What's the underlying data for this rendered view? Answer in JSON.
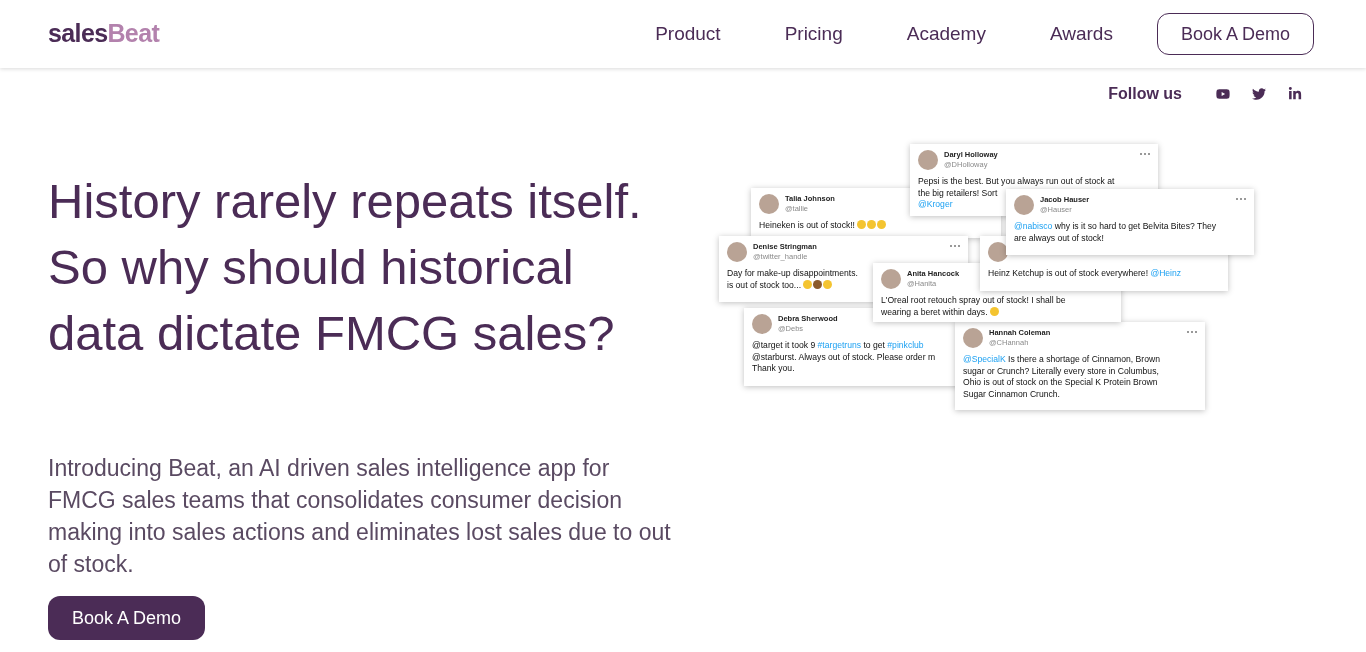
{
  "header": {
    "logo": {
      "first": "sales",
      "second": "Beat"
    },
    "nav": [
      "Product",
      "Pricing",
      "Academy",
      "Awards"
    ],
    "cta": "Book A Demo"
  },
  "social": {
    "label": "Follow us",
    "icons": [
      {
        "kind": "youtube"
      },
      {
        "kind": "twitter"
      },
      {
        "kind": "linkedin"
      }
    ]
  },
  "hero": {
    "headline": [
      "History rarely repeats itself.",
      "So why should historical",
      "data dictate FMCG sales?"
    ],
    "intro": "Introducing Beat, an AI driven sales intelligence app for FMCG sales teams that consolidates consumer decision making into sales actions and eliminates lost sales due to out of stock.",
    "button": "Book A Demo"
  },
  "tweets": [
    {
      "name": "Talia Johnson",
      "handle": "@tallie",
      "menu": false,
      "lines": [
        [
          {
            "kind": "text",
            "t": "Heineken is out of stock!! "
          },
          {
            "kind": "emoji",
            "color": "#f4c430"
          },
          {
            "kind": "emoji",
            "color": "#f4c430"
          },
          {
            "kind": "emoji",
            "color": "#f4c430"
          }
        ]
      ]
    },
    {
      "name": "Daryl Holloway",
      "handle": "@DHolloway",
      "menu": true,
      "lines": [
        [
          {
            "kind": "text",
            "t": "Pepsi is the best. But you always run out of stock at"
          }
        ],
        [
          {
            "kind": "text",
            "t": "the big retailers! Sort"
          }
        ],
        [
          {
            "kind": "mention",
            "t": "@Kroger"
          }
        ]
      ]
    },
    {
      "name": "Denise Stringman",
      "handle": "@twitter_handle",
      "menu": true,
      "lines": [
        [
          {
            "kind": "text",
            "t": "Day for make-up disappointments."
          }
        ],
        [
          {
            "kind": "text",
            "t": "is out of stock too... "
          },
          {
            "kind": "emoji",
            "color": "#f4c430"
          },
          {
            "kind": "emoji",
            "color": "#8b5a2b"
          },
          {
            "kind": "emoji",
            "color": "#f4c430"
          }
        ]
      ]
    },
    {
      "name": "Debra Sherwood",
      "handle": "@Debs",
      "menu": false,
      "lines": [
        [
          {
            "kind": "text",
            "t": "@target it took 9 "
          },
          {
            "kind": "mention",
            "t": "#targetruns"
          },
          {
            "kind": "text",
            "t": " to get "
          },
          {
            "kind": "mention",
            "t": "#pinkclub"
          }
        ],
        [
          {
            "kind": "text",
            "t": "@starburst. Always out of stock. Please order m"
          }
        ],
        [
          {
            "kind": "text",
            "t": "Thank you."
          }
        ]
      ]
    },
    {
      "name": "Hannah Coleman",
      "handle": "@CHannah",
      "menu": true,
      "lines": [
        [
          {
            "kind": "mention",
            "t": "@SpecialK"
          },
          {
            "kind": "text",
            "t": " Is there a shortage of Cinnamon, Brown"
          }
        ],
        [
          {
            "kind": "text",
            "t": "sugar or Crunch? Literally every store in Columbus,"
          }
        ],
        [
          {
            "kind": "text",
            "t": "Ohio is out of stock on the Special K Protein Brown"
          }
        ],
        [
          {
            "kind": "text",
            "t": "Sugar Cinnamon Crunch."
          }
        ]
      ]
    },
    {
      "name": "Anita Hancock",
      "handle": "@Hanita",
      "menu": false,
      "lines": [
        [
          {
            "kind": "text",
            "t": "L'Oreal root retouch spray out of stock! I shall be"
          }
        ],
        [
          {
            "kind": "text",
            "t": "wearing a beret within days. "
          },
          {
            "kind": "emoji",
            "color": "#f4c430"
          }
        ]
      ]
    },
    {
      "menu": false,
      "lines": [
        [
          {
            "kind": "text",
            "t": "Heinz Ketchup is out of stock everywhere! "
          },
          {
            "kind": "mention",
            "t": "@Heinz"
          }
        ]
      ]
    },
    {
      "name": "Jacob Hauser",
      "handle": "@Hauser",
      "menu": true,
      "lines": [
        [
          {
            "kind": "mention",
            "t": "@nabisco"
          },
          {
            "kind": "text",
            "t": " why is it so hard to get Belvita Bites? They"
          }
        ],
        [
          {
            "kind": "text",
            "t": "are always out of stock!"
          }
        ]
      ]
    }
  ]
}
